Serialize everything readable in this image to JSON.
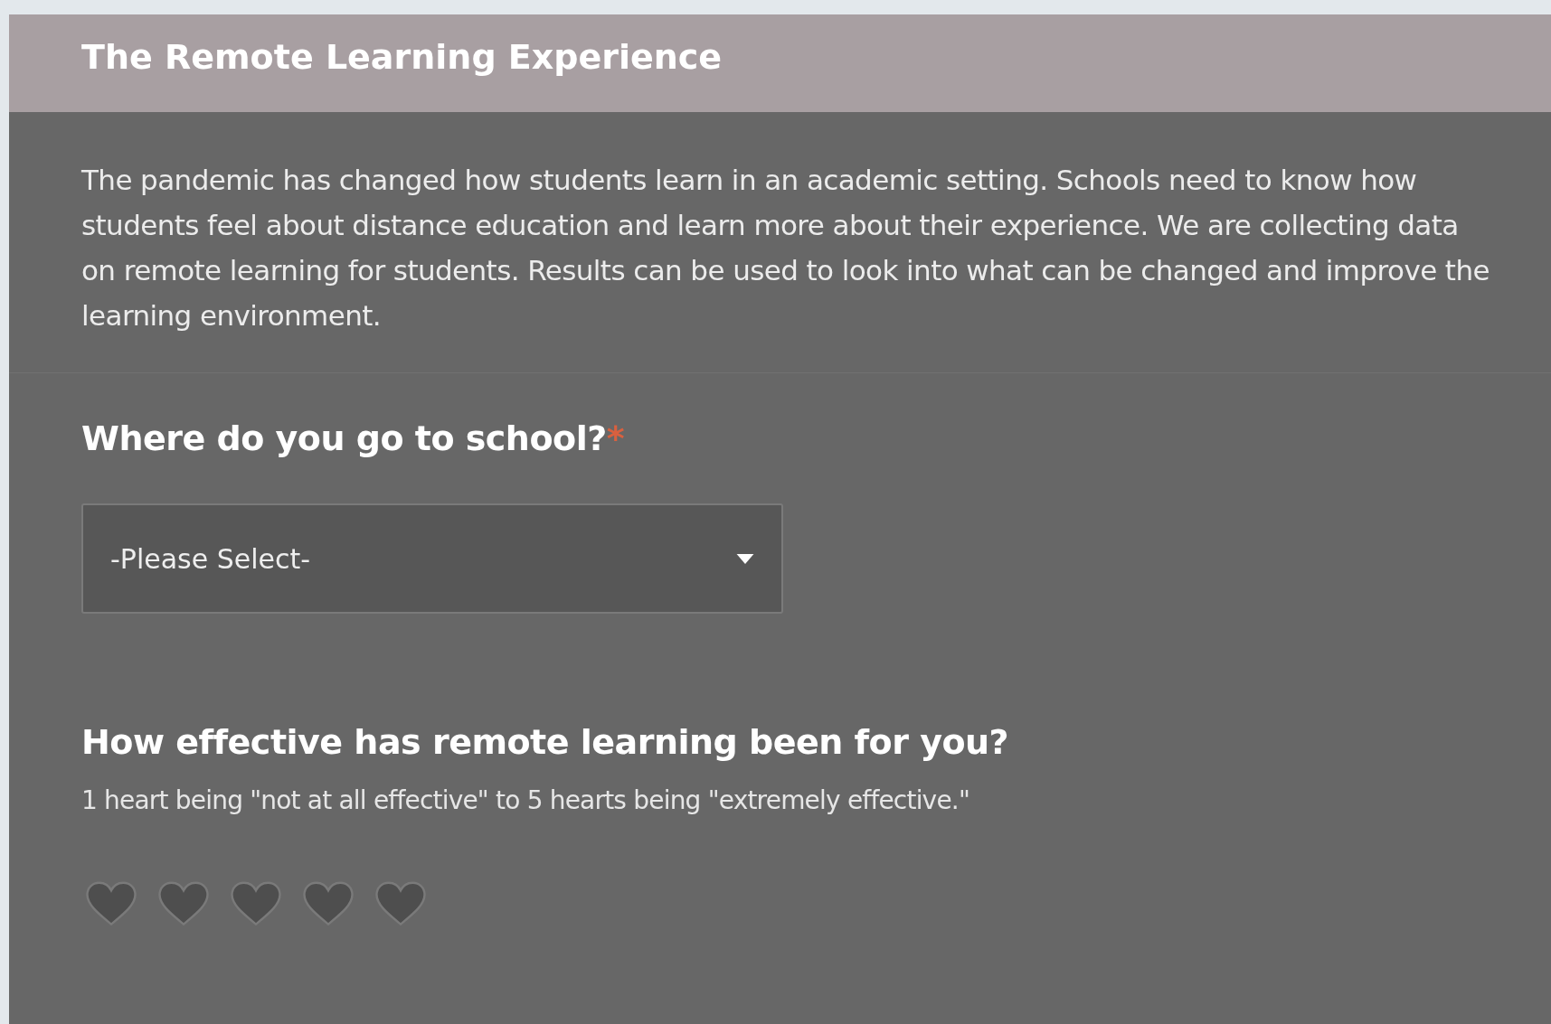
{
  "form": {
    "title": "The Remote Learning Experience",
    "description": "The pandemic has changed how students learn in an academic setting. Schools need to know how students feel about distance education and learn more about their experience. We are collecting data on remote learning for students. Results can be used to look into what can be changed and improve the learning environment."
  },
  "questions": [
    {
      "kind": "dropdown",
      "label": "Where do you go to school?",
      "required": true,
      "required_mark": "*",
      "placeholder": "-Please Select-"
    },
    {
      "kind": "rating",
      "label": "How effective has remote learning been for you?",
      "hint": "1 heart being \"not at all effective\" to 5 hearts being \"extremely effective.\"",
      "stars": 0
    }
  ]
}
